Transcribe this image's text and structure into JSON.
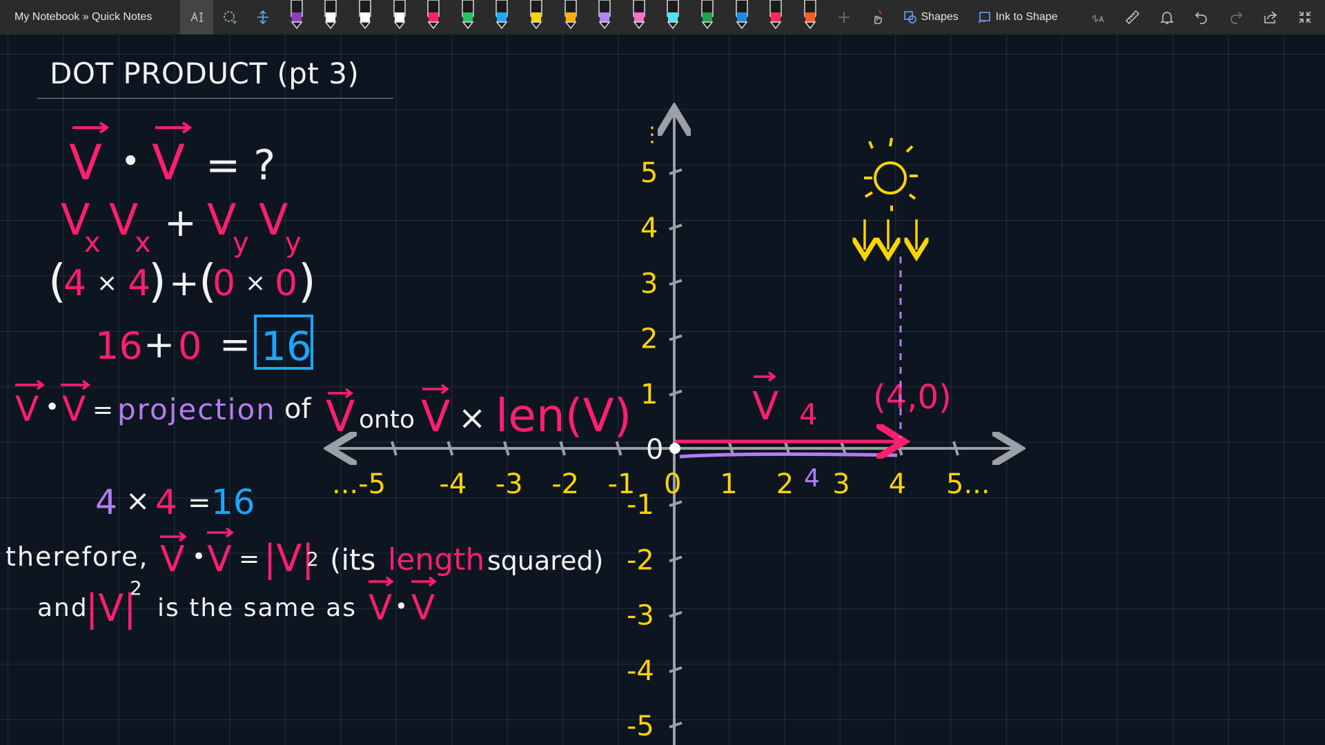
{
  "app": {
    "breadcrumb": "My Notebook » Quick Notes"
  },
  "toolbar": {
    "tools_left": [
      {
        "name": "lasso-select-icon"
      },
      {
        "name": "add-space-icon"
      },
      {
        "name": "insert-space-icon"
      }
    ],
    "pens": [
      {
        "color": "#8b3fbf"
      },
      {
        "color": "#ffffff"
      },
      {
        "color": "#ffffff"
      },
      {
        "color": "#ffffff"
      },
      {
        "color": "#ff1f6e"
      },
      {
        "color": "#22c55e"
      },
      {
        "color": "#1aa7ff"
      },
      {
        "color": "#ffd400"
      },
      {
        "color": "#ffb000"
      },
      {
        "color": "#b084f5"
      },
      {
        "color": "#ff6ec7"
      },
      {
        "color": "#4de3ff"
      },
      {
        "color": "#21a047"
      },
      {
        "color": "#1e88e5"
      },
      {
        "color": "#ff2a55"
      },
      {
        "color": "#ff5a1f"
      }
    ],
    "shapes_label": "Shapes",
    "ink_to_shape_label": "Ink to Shape",
    "right_icons": [
      "ink-to-text-icon",
      "ruler-icon",
      "notification-bell-icon",
      "undo-icon",
      "redo-icon",
      "share-icon",
      "fullscreen-icon"
    ]
  },
  "page": {
    "title": "DOT PRODUCT (pt 3)"
  },
  "notes": {
    "line1_left": "V",
    "line1_dot": "•",
    "line1_right": "V",
    "line1_eq": "= ?",
    "line2": "Vx Vx + Vy Vy",
    "line2_parts": {
      "v1": "V",
      "s1": "x",
      "v2": "V",
      "s2": "x",
      "plus": "+",
      "v3": "V",
      "s3": "y",
      "v4": "V",
      "s4": "y"
    },
    "line3_parts": {
      "lp": "(",
      "a": "4",
      "times1": "×",
      "b": "4",
      "rp": ")",
      "plus": "+",
      "lp2": "(",
      "c": "0",
      "times2": "×",
      "d": "0",
      "rp2": ")"
    },
    "line4_parts": {
      "a": "16",
      "plus": "+",
      "b": "0",
      "eq": "=",
      "result": "16"
    },
    "line5_parts": {
      "v1": "V",
      "dot": "•",
      "v2": "V",
      "eq": "=",
      "projection": "projection",
      "of": "of",
      "v3": "V",
      "onto": "onto",
      "v4": "V",
      "times": "×",
      "len": "len(V)"
    },
    "line6_parts": {
      "a": "4",
      "times": "×",
      "b": "4",
      "eq": "=",
      "r": "16"
    },
    "line7_parts": {
      "therefore": "therefore,",
      "v1": "V",
      "dot": "•",
      "v2": "V",
      "eq": "=",
      "abs": "|V|",
      "sq": "2",
      "open": "(its",
      "length": "length",
      "squared": "squared)"
    },
    "line8_parts": {
      "and": "and",
      "abs": "|V|",
      "sq": "2",
      "same": "is the same as",
      "v1": "V",
      "dot": "•",
      "v2": "V"
    }
  },
  "graph": {
    "x_ticks": [
      "...-5",
      "-4",
      "-3",
      "-2",
      "-1",
      "0",
      "1",
      "2",
      "3",
      "4",
      "5..."
    ],
    "y_ticks_pos": [
      "5",
      "4",
      "3",
      "2",
      "1",
      "0"
    ],
    "y_ticks_neg": [
      "-1",
      "-2",
      "-3",
      "-4",
      "-5"
    ],
    "y_dots": "⋮",
    "vector_label": "V",
    "vector_len_label": "4",
    "projection_len_label": "4",
    "point_label": "(4,0)"
  },
  "colors": {
    "pink": "#ff1f6e",
    "white": "#f2f2f2",
    "purple": "#b57cf0",
    "blue": "#1aa7ff",
    "yellow": "#ffd400",
    "axis": "#9aa0a6"
  }
}
